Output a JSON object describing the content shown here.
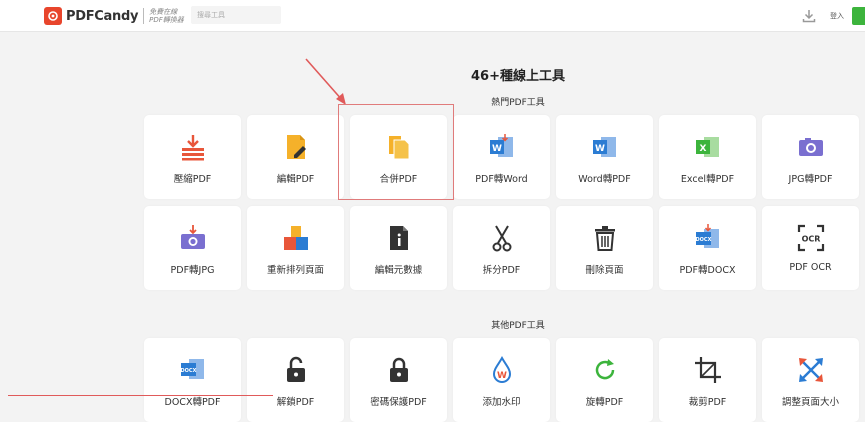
{
  "header": {
    "brand": "PDFCandy",
    "tagline_line1": "免費在線",
    "tagline_line2": "PDF轉換器",
    "search_placeholder": "搜尋工具",
    "login_label": "登入"
  },
  "main_title": "46+種線上工具",
  "popular": {
    "title": "熱門PDF工具",
    "tools": [
      {
        "label": "壓縮PDF",
        "icon": "compress-icon"
      },
      {
        "label": "編輯PDF",
        "icon": "edit-pdf-icon"
      },
      {
        "label": "合併PDF",
        "icon": "merge-icon"
      },
      {
        "label": "PDF轉Word",
        "icon": "pdf-to-word-icon"
      },
      {
        "label": "Word轉PDF",
        "icon": "word-to-pdf-icon"
      },
      {
        "label": "Excel轉PDF",
        "icon": "excel-to-pdf-icon"
      },
      {
        "label": "JPG轉PDF",
        "icon": "jpg-to-pdf-icon"
      },
      {
        "label": "PDF轉JPG",
        "icon": "pdf-to-jpg-icon"
      },
      {
        "label": "重新排列頁面",
        "icon": "rearrange-icon"
      },
      {
        "label": "編輯元數據",
        "icon": "metadata-icon"
      },
      {
        "label": "拆分PDF",
        "icon": "scissors-icon"
      },
      {
        "label": "刪除頁面",
        "icon": "trash-icon"
      },
      {
        "label": "PDF轉DOCX",
        "icon": "pdf-to-docx-icon"
      },
      {
        "label": "PDF OCR",
        "icon": "ocr-icon"
      }
    ]
  },
  "other": {
    "title": "其他PDF工具",
    "tools": [
      {
        "label": "DOCX轉PDF",
        "icon": "docx-to-pdf-icon"
      },
      {
        "label": "解鎖PDF",
        "icon": "unlock-icon"
      },
      {
        "label": "密碼保護PDF",
        "icon": "lock-icon"
      },
      {
        "label": "添加水印",
        "icon": "watermark-icon"
      },
      {
        "label": "旋轉PDF",
        "icon": "rotate-icon"
      },
      {
        "label": "裁剪PDF",
        "icon": "crop-icon"
      },
      {
        "label": "調整頁面大小",
        "icon": "resize-icon"
      }
    ]
  },
  "colors": {
    "brand": "#e8452c",
    "accent_orange": "#f5b12a",
    "word_blue": "#2b7cd3",
    "excel_green": "#3cb43c",
    "purple": "#7a6fd0",
    "annotation_red": "#e05a5a"
  }
}
